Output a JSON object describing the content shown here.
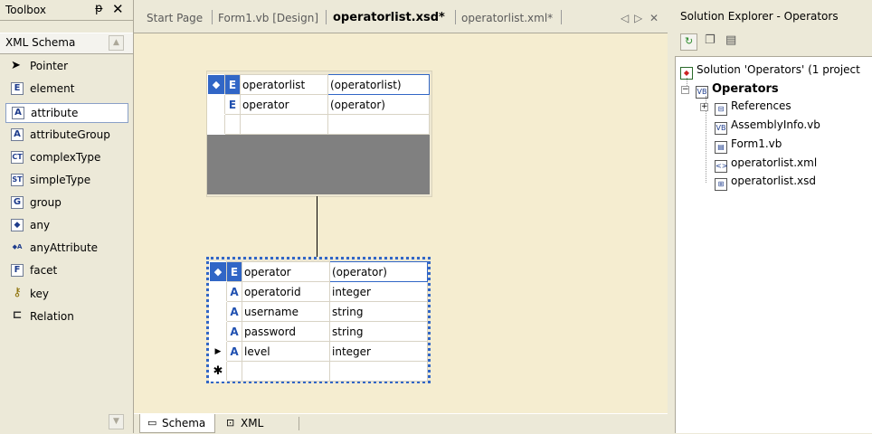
{
  "toolbox": {
    "title": "Toolbox",
    "pin": "ᵽ",
    "close": "✕",
    "tab": "XML Schema",
    "items": [
      {
        "label": "Pointer",
        "icon": "pointer-icon",
        "glyph": "➤"
      },
      {
        "label": "element",
        "icon": "element-icon",
        "glyph": "E"
      },
      {
        "label": "attribute",
        "icon": "attribute-icon",
        "glyph": "A"
      },
      {
        "label": "attributeGroup",
        "icon": "attribute-group-icon",
        "glyph": "A"
      },
      {
        "label": "complexType",
        "icon": "complex-type-icon",
        "glyph": "CT"
      },
      {
        "label": "simpleType",
        "icon": "simple-type-icon",
        "glyph": "ST"
      },
      {
        "label": "group",
        "icon": "group-icon",
        "glyph": "G"
      },
      {
        "label": "any",
        "icon": "any-icon",
        "glyph": "◆"
      },
      {
        "label": "anyAttribute",
        "icon": "any-attribute-icon",
        "glyph": "◆A"
      },
      {
        "label": "facet",
        "icon": "facet-icon",
        "glyph": "F"
      },
      {
        "label": "key",
        "icon": "key-icon",
        "glyph": "⚷"
      },
      {
        "label": "Relation",
        "icon": "relation-icon",
        "glyph": "⊏"
      }
    ]
  },
  "tabs": [
    {
      "label": "Start Page",
      "active": false
    },
    {
      "label": "Form1.vb [Design]",
      "active": false
    },
    {
      "label": "operatorlist.xsd*",
      "active": true
    },
    {
      "label": "operatorlist.xml*",
      "active": false
    }
  ],
  "tab_controls": {
    "prev": "◁",
    "next": "▷",
    "close": "✕"
  },
  "tables": {
    "operatorlist": {
      "rows": [
        {
          "kind": "E",
          "name": "operatorlist",
          "type": "(operatorlist)"
        },
        {
          "kind": "E",
          "name": "operator",
          "type": "(operator)"
        }
      ]
    },
    "operator": {
      "rows": [
        {
          "kind": "E",
          "name": "operator",
          "type": "(operator)"
        },
        {
          "kind": "A",
          "name": "operatorid",
          "type": "integer"
        },
        {
          "kind": "A",
          "name": "username",
          "type": "string"
        },
        {
          "kind": "A",
          "name": "password",
          "type": "string"
        },
        {
          "kind": "A",
          "name": "level",
          "type": "integer"
        }
      ],
      "new_row": "✱"
    }
  },
  "bottom_tabs": [
    {
      "label": "Schema",
      "active": true
    },
    {
      "label": "XML",
      "active": false
    }
  ],
  "solution": {
    "title": "Solution Explorer - Operators",
    "root": "Solution 'Operators' (1 project",
    "project": "Operators",
    "items": [
      "References",
      "AssemblyInfo.vb",
      "Form1.vb",
      "operatorlist.xml",
      "operatorlist.xsd"
    ]
  },
  "colors": {
    "accent": "#3166C6",
    "canvas": "#F5EDD0",
    "chrome": "#ECE9D8"
  }
}
